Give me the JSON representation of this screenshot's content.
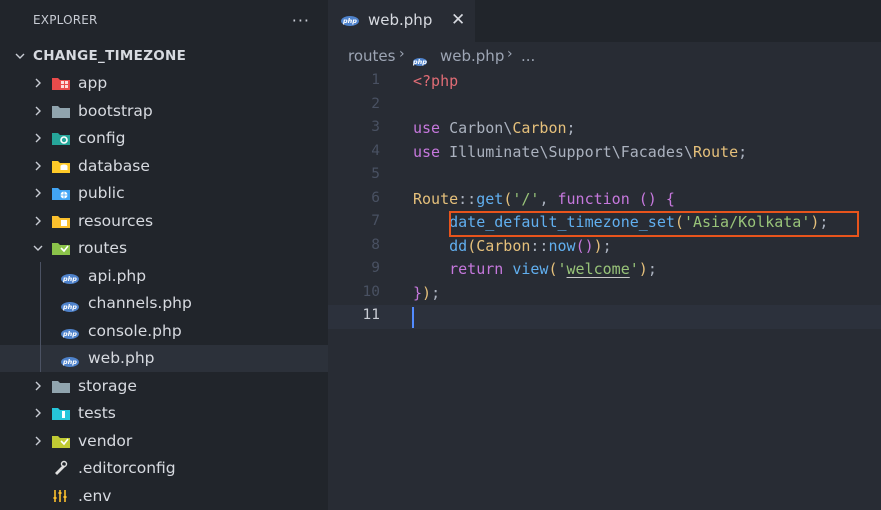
{
  "explorer": {
    "title": "EXPLORER",
    "more_label": "···",
    "root_label": "CHANGE_TIMEZONE",
    "items": [
      {
        "label": "app",
        "icon": "app-folder-icon"
      },
      {
        "label": "bootstrap",
        "icon": "folder-icon"
      },
      {
        "label": "config",
        "icon": "config-folder-icon"
      },
      {
        "label": "database",
        "icon": "database-folder-icon"
      },
      {
        "label": "public",
        "icon": "public-folder-icon"
      },
      {
        "label": "resources",
        "icon": "resources-folder-icon"
      },
      {
        "label": "routes",
        "icon": "routes-folder-open-icon"
      },
      {
        "label": "api.php",
        "icon": "php-file-icon"
      },
      {
        "label": "channels.php",
        "icon": "php-file-icon"
      },
      {
        "label": "console.php",
        "icon": "php-file-icon"
      },
      {
        "label": "web.php",
        "icon": "php-file-icon"
      },
      {
        "label": "storage",
        "icon": "folder-icon"
      },
      {
        "label": "tests",
        "icon": "tests-folder-icon"
      },
      {
        "label": "vendor",
        "icon": "vendor-folder-icon"
      },
      {
        "label": ".editorconfig",
        "icon": "editorconfig-file-icon"
      },
      {
        "label": ".env",
        "icon": "env-file-icon"
      }
    ]
  },
  "php_badge": "php",
  "tab": {
    "label": "web.php",
    "close": "✕"
  },
  "breadcrumb": {
    "part1": "routes",
    "sep": "›",
    "file": "web.php",
    "more": "..."
  },
  "editor": {
    "line_numbers": [
      "1",
      "2",
      "3",
      "4",
      "5",
      "6",
      "7",
      "8",
      "9",
      "10",
      "11"
    ],
    "active_line": "11",
    "code": {
      "l1_open": "<?php",
      "use": "use",
      "l3_ns": "Carbon",
      "bs": "\\",
      "l3_cls": "Carbon",
      "semi": ";",
      "l4_ns1": "Illuminate",
      "l4_ns2": "Support",
      "l4_ns3": "Facades",
      "l4_cls": "Route",
      "route": "Route",
      "dcolon": "::",
      "get": "get",
      "lparen": "(",
      "rparen": ")",
      "root_str": "'/'",
      "comma": ", ",
      "function": "function",
      "fn_parens": " () ",
      "lbrace": "{",
      "tz_fn": "date_default_timezone_set",
      "tz_str": "'Asia/Kolkata'",
      "dd": "dd",
      "carbon": "Carbon",
      "now": "now",
      "return": "return",
      "view": "view",
      "q": "'",
      "welcome": "welcome",
      "close": "});"
    }
  },
  "colors": {
    "accent": "#528bff",
    "highlight_box": "#e8541c"
  }
}
